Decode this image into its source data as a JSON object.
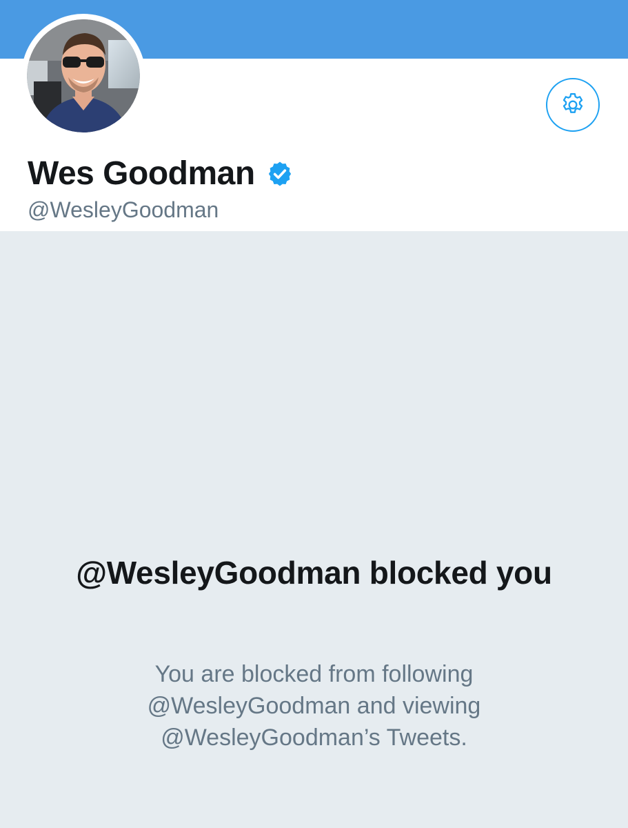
{
  "profile": {
    "display_name": "Wes Goodman",
    "handle": "@WesleyGoodman",
    "verified_icon": "verified-badge-icon",
    "avatar_icon": "profile-photo",
    "settings_icon": "gear-icon"
  },
  "blocked": {
    "title": "@WesleyGoodman blocked you",
    "message": "You are blocked from following @WesleyGoodman and viewing @WesleyGoodman’s Tweets."
  },
  "colors": {
    "banner": "#4a9ae3",
    "accent": "#1da1f2",
    "background": "#e6ecf0",
    "text_primary": "#14171a",
    "text_secondary": "#657786"
  }
}
